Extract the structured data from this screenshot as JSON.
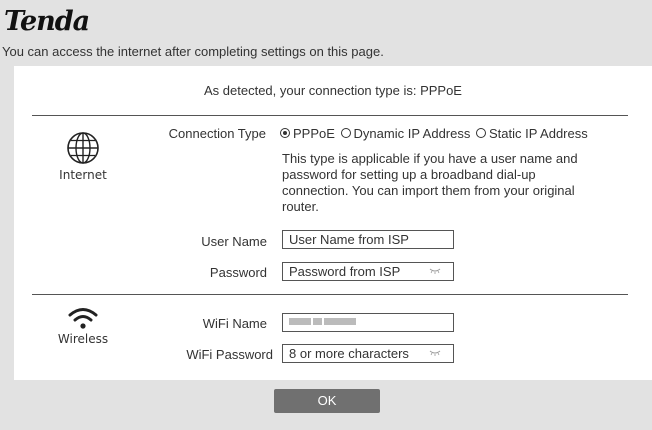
{
  "header": {
    "logo_text": "Tenda",
    "subtitle": "You can access the internet after completing settings on this page."
  },
  "detection": {
    "text": "As detected, your connection type is: PPPoE"
  },
  "internet": {
    "caption": "Internet",
    "icon": "globe-icon",
    "connection_type_label": "Connection Type",
    "options": [
      {
        "label": "PPPoE",
        "selected": true
      },
      {
        "label": "Dynamic IP Address",
        "selected": false
      },
      {
        "label": "Static IP Address",
        "selected": false
      }
    ],
    "description": "This type is applicable if you have a user name and password for setting up a broadband dial-up connection. You can import them from your original router.",
    "user_name_label": "User Name",
    "user_name_placeholder": "User Name from ISP",
    "password_label": "Password",
    "password_placeholder": "Password from ISP"
  },
  "wireless": {
    "caption": "Wireless",
    "icon": "wifi-icon",
    "wifi_name_label": "WiFi Name",
    "wifi_password_label": "WiFi Password",
    "wifi_password_placeholder": "8 or more characters"
  },
  "actions": {
    "ok_label": "OK"
  },
  "colors": {
    "page_bg": "#e2e2e2",
    "card_bg": "#ffffff",
    "button_bg": "#707070"
  }
}
